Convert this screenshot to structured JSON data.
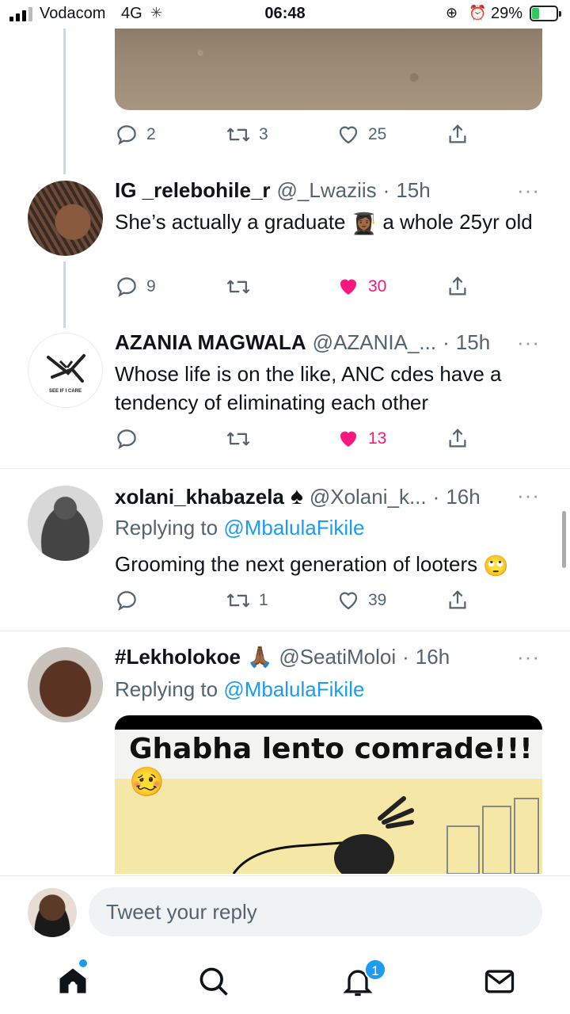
{
  "status_bar": {
    "carrier": "Vodacom",
    "network": "4G",
    "time": "06:48",
    "battery_percent": "29%",
    "battery_level": 0.29
  },
  "top_tweet_actions": {
    "replies": "2",
    "retweets": "3",
    "likes": "25"
  },
  "tweets": [
    {
      "name": "IG _relebohile_r",
      "handle": "@_Lwaziis",
      "dot": "·",
      "time": "15h",
      "text_a": "She’s actually a graduate",
      "emoji": "👩🏾‍🎓",
      "text_b": "a whole 25yr old",
      "replies": "9",
      "retweets": "",
      "likes": "30",
      "liked": true
    },
    {
      "name": "AZANIA MAGWALA",
      "handle": "@AZANIA_...",
      "dot": "·",
      "time": "15h",
      "text": "Whose life is on the like, ANC cdes have a tendency of eliminating each other",
      "replies": "",
      "retweets": "",
      "likes": "13",
      "liked": true,
      "avatar_text": "SEE IF I CARE"
    },
    {
      "name": "xolani_khabazela",
      "name_emoji": "♠",
      "handle": "@Xolani_k...",
      "dot": "·",
      "time": "16h",
      "replying_prefix": "Replying to",
      "replying_to": "@MbalulaFikile",
      "text": "Grooming the next generation of looters",
      "text_emoji": "🙄",
      "replies": "",
      "retweets": "1",
      "likes": "39",
      "liked": false
    },
    {
      "name": "#Lekholokoe",
      "name_emoji": "🙏🏾",
      "handle": "@SeatiMoloi",
      "dot": "·",
      "time": "16h",
      "replying_prefix": "Replying to",
      "replying_to": "@MbalulaFikile",
      "meme_caption": "Ghabha lento comrade!!!🥴"
    }
  ],
  "more_label": "···",
  "reply_bar": {
    "placeholder": "Tweet your reply"
  },
  "bottom_nav": {
    "notifications_badge": "1"
  },
  "colors": {
    "accent": "#1d9bf0",
    "like": "#f91880",
    "muted": "#536471"
  }
}
